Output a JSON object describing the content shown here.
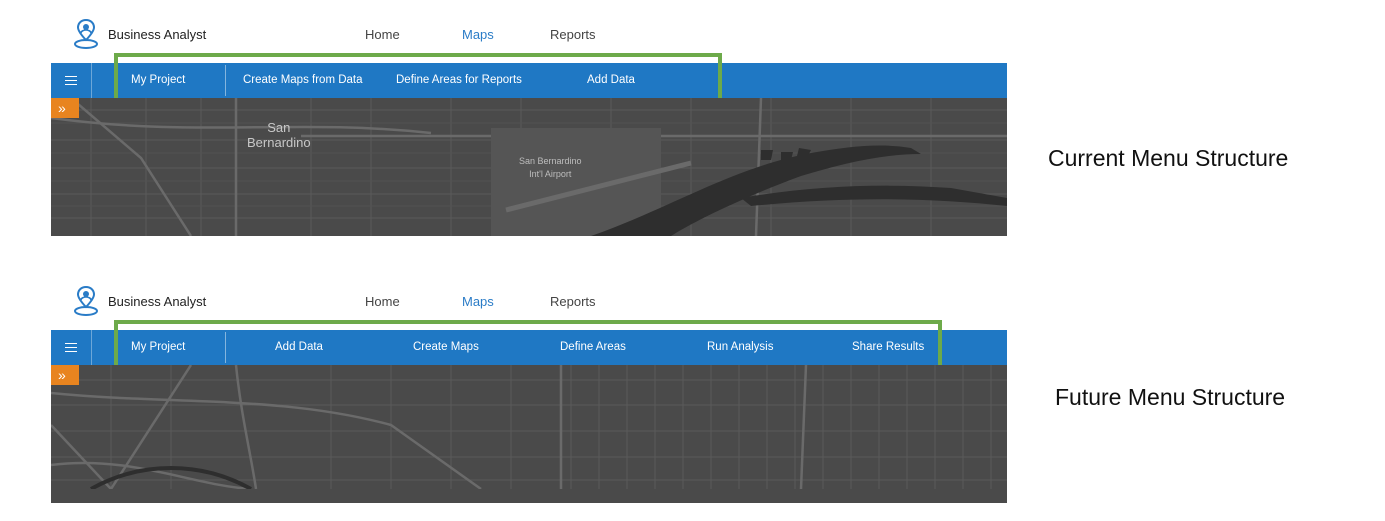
{
  "current": {
    "app_title": "Business Analyst",
    "nav": [
      "Home",
      "Maps",
      "Reports"
    ],
    "tabs": [
      "My Project",
      "Create Maps from Data",
      "Define Areas for Reports",
      "Add Data"
    ],
    "map_labels": {
      "city": [
        "San",
        "Bernardino"
      ],
      "airport": [
        "San Bernardino",
        "Int'l Airport"
      ]
    },
    "caption": "Current Menu Structure"
  },
  "future": {
    "app_title": "Business Analyst",
    "nav": [
      "Home",
      "Maps",
      "Reports"
    ],
    "tabs": [
      "My Project",
      "Add Data",
      "Create Maps",
      "Define Areas",
      "Run Analysis",
      "Share Results"
    ],
    "caption": "Future Menu Structure"
  },
  "icons": {
    "logo": "location-pin-person-icon",
    "menu": "hamburger-icon",
    "expand": "double-chevron-right-icon"
  },
  "colors": {
    "toolbar": "#1f78c4",
    "highlight": "#6daa4a",
    "active_nav": "#2a7cc7",
    "expand": "#e8841f",
    "map": "#4a4a4a"
  }
}
